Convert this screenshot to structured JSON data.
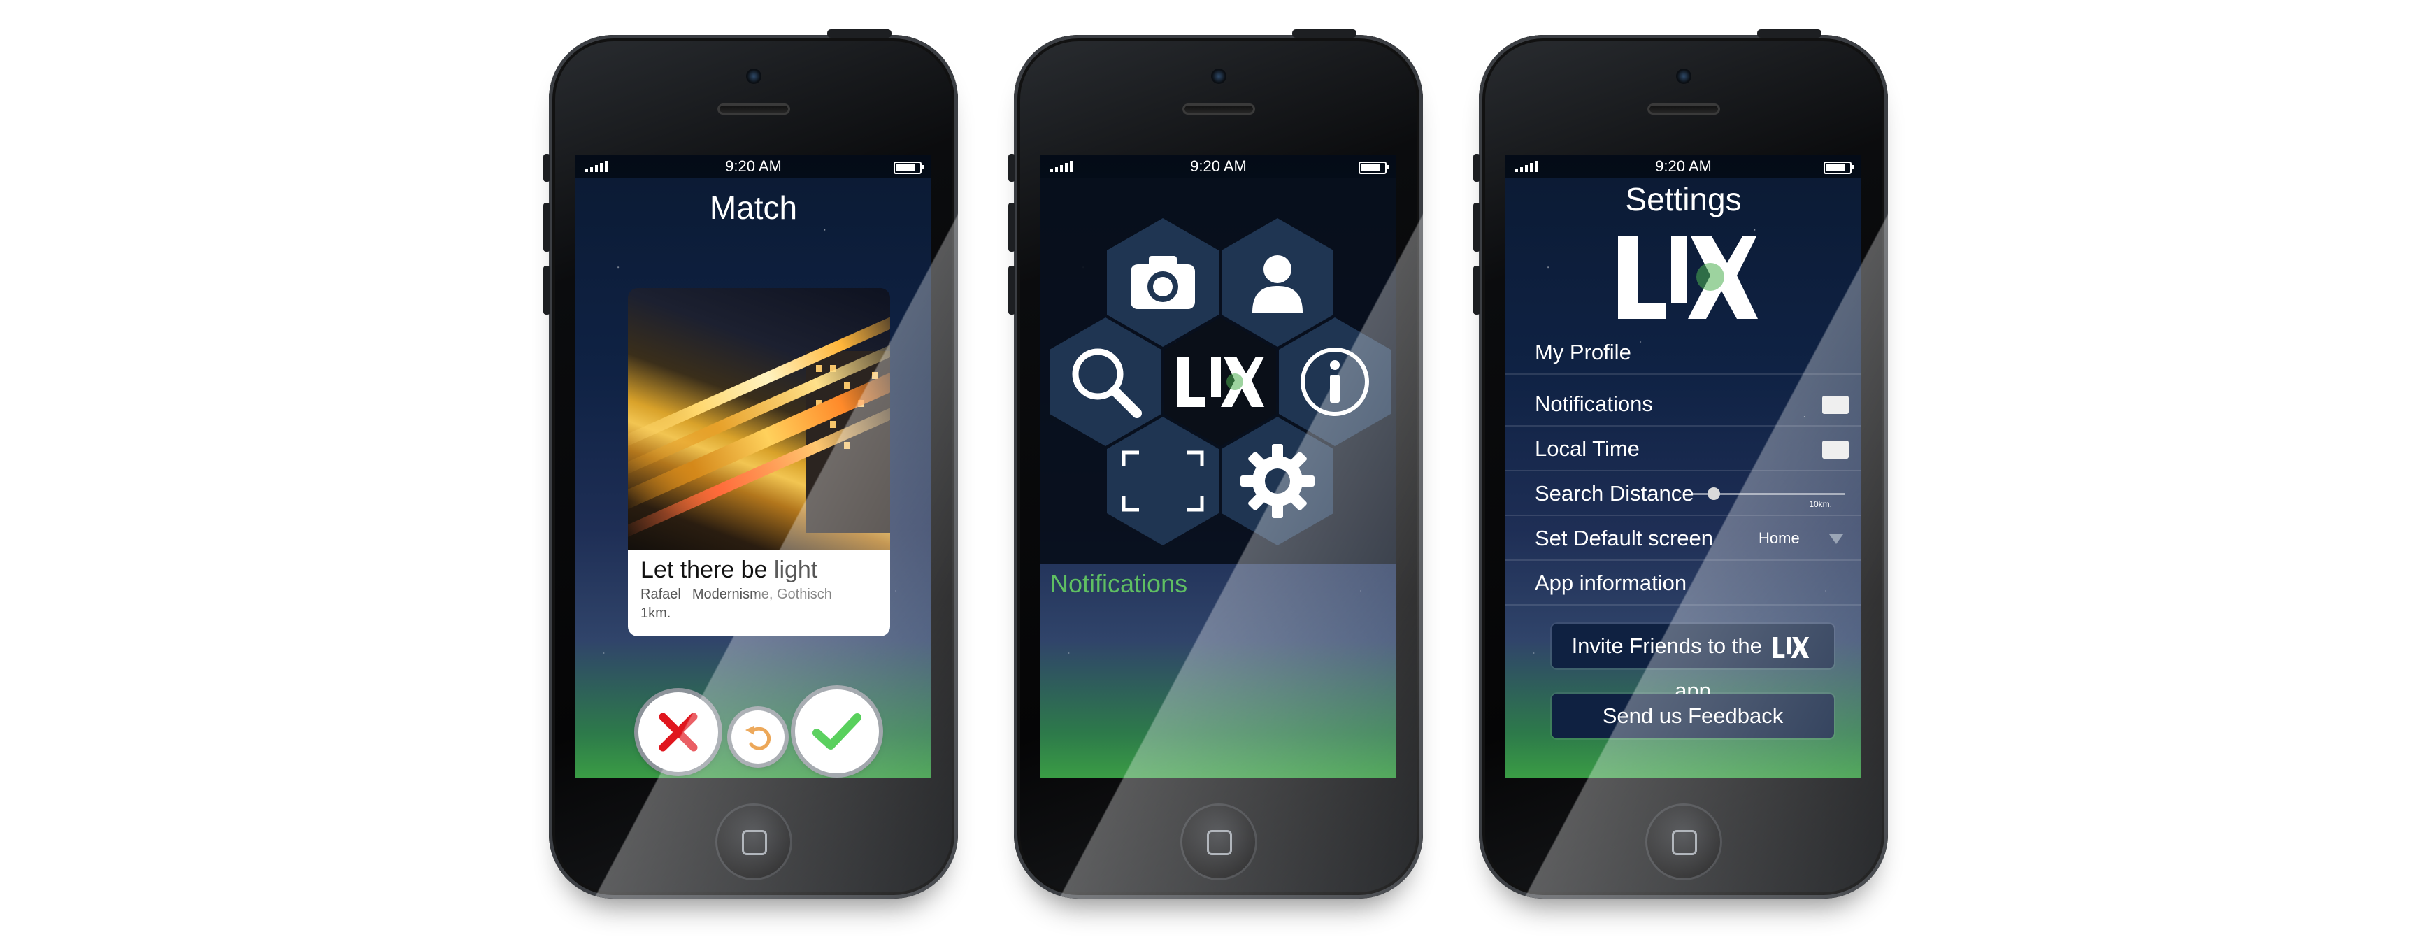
{
  "statusbar": {
    "time": "9:20 AM"
  },
  "match": {
    "title": "Match",
    "card": {
      "name": "Let there be light",
      "user": "Rafael",
      "tags": "Modernisme, Gothisch",
      "distance": "1km."
    }
  },
  "menu": {
    "tiles": [
      "camera-icon",
      "profile-icon",
      "search-icon",
      "lux-logo",
      "info-icon",
      "scan-frame-icon",
      "gear-icon"
    ],
    "notifications_label": "Notifications"
  },
  "settings": {
    "title": "Settings",
    "rows": {
      "my_profile": "My Profile",
      "notifications": "Notifications",
      "local_time": "Local Time",
      "search_distance": "Search Distance",
      "search_distance_max": "10km.",
      "search_distance_level": 0.15,
      "default_screen": "Set Default screen",
      "default_screen_value": "Home",
      "app_information": "App information"
    },
    "invite_prefix": "Invite Friends to the",
    "invite_suffix": "app",
    "feedback": "Send us Feedback"
  },
  "colors": {
    "accept_green": "#2ec433",
    "reject_red": "#e0161e",
    "undo_orange": "#e6891f",
    "notif_green": "#5fbf62"
  }
}
